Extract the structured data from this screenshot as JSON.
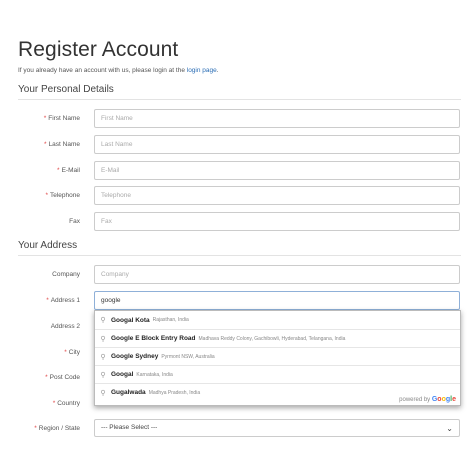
{
  "page": {
    "title": "Register Account",
    "intro_text": "If you already have an account with us, please login at the ",
    "intro_link": "login page",
    "intro_end": "."
  },
  "personal": {
    "legend": "Your Personal Details",
    "first_name": {
      "label": "First Name",
      "placeholder": "First Name"
    },
    "last_name": {
      "label": "Last Name",
      "placeholder": "Last Name"
    },
    "email": {
      "label": "E-Mail",
      "placeholder": "E-Mail"
    },
    "telephone": {
      "label": "Telephone",
      "placeholder": "Telephone"
    },
    "fax": {
      "label": "Fax",
      "placeholder": "Fax"
    }
  },
  "address": {
    "legend": "Your Address",
    "company": {
      "label": "Company",
      "placeholder": "Company"
    },
    "address1": {
      "label": "Address 1",
      "value": "google"
    },
    "address2": {
      "label": "Address 2"
    },
    "city": {
      "label": "City"
    },
    "postcode": {
      "label": "Post Code"
    },
    "country": {
      "label": "Country"
    },
    "region": {
      "label": "Region / State",
      "selected": "--- Please Select ---"
    }
  },
  "required_mark": "*",
  "autocomplete": {
    "suggestions": [
      {
        "main": "Googal Kota",
        "secondary": "Rajasthan, India"
      },
      {
        "main": "Google E Block Entry Road",
        "secondary": "Madhava Reddy Colony, Gachibowli, Hyderabad, Telangana, India"
      },
      {
        "main": "Google Sydney",
        "secondary": "Pyrmont NSW, Australia"
      },
      {
        "main": "Googal",
        "secondary": "Karnataka, India"
      },
      {
        "main": "Gugalwada",
        "secondary": "Madhya Pradesh, India"
      }
    ],
    "powered_by": "powered by ",
    "logo_letters": [
      "G",
      "o",
      "o",
      "g",
      "l",
      "e"
    ]
  }
}
